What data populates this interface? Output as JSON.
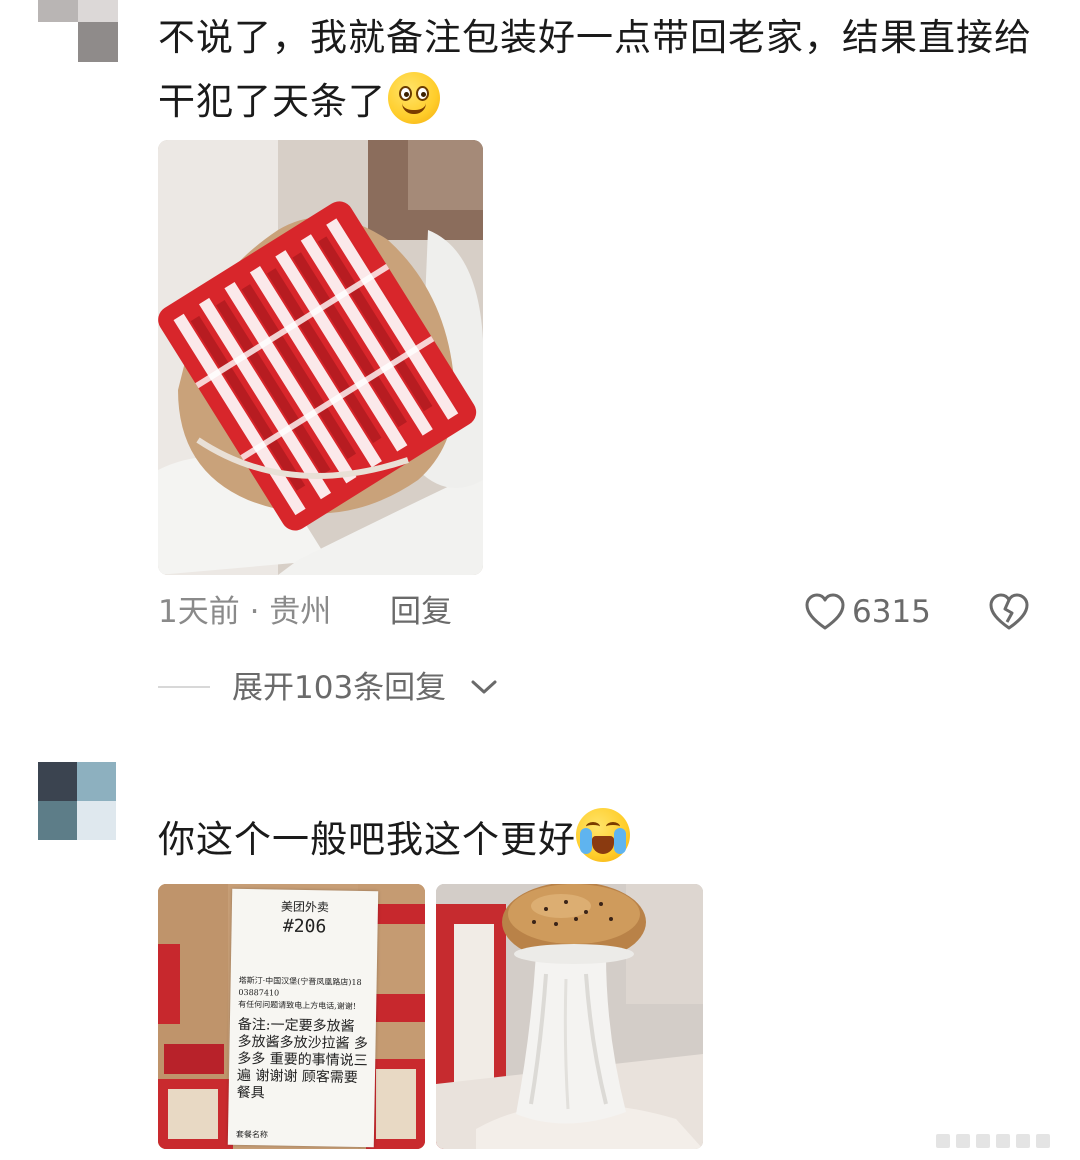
{
  "comment1": {
    "text": "不说了，我就备注包装好一点带回老家，结果直接给干犯了天条了",
    "emoji": "grinning-emoji-icon",
    "time_location": "1天前 · 贵州",
    "reply_label": "回复",
    "like_count": "6315",
    "expand_replies_label": "展开103条回复",
    "photo": "wrapped-burger-package-photo"
  },
  "comment2": {
    "text": "你这个一般吧我这个更好",
    "emoji": "crying-laughing-emoji-icon",
    "receipt": {
      "brand": "美团外卖",
      "order_number": "#206",
      "store_info": "塔斯汀·中国汉堡(宁晋凤凰路店)18 03887410",
      "help_line": "有任何问题请致电上方电话,谢谢!",
      "note": "备注:一定要多放酱 多放酱多放沙拉酱 多多多 重要的事情说三遍 谢谢谢 顾客需要餐具",
      "footer": "套餐名称"
    },
    "photos": [
      "receipt-photo",
      "burger-with-sauce-photo"
    ]
  },
  "colors": {
    "text_primary": "#1a1a1a",
    "text_meta": "#8a8a8a",
    "text_action": "#6a6a6a",
    "wrapper_red": "#d8262b"
  }
}
